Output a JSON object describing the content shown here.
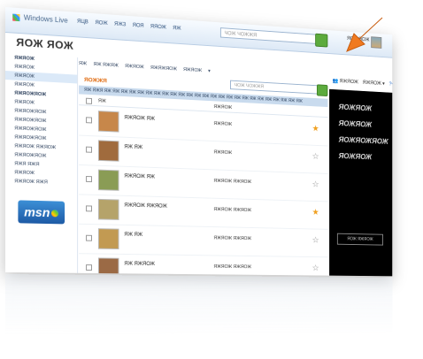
{
  "header": {
    "brand": "Windows Live",
    "nav": [
      "ЯЦВ",
      "ЯОЖ",
      "ЯЖЗ",
      "ЯОЯ",
      "ЯЯОЖ",
      "ЯЖ"
    ],
    "search_placeholder": "ЧОЖ ЧОЖЖЯ",
    "user": "ЯОЯ ЯОЖ"
  },
  "page": {
    "title": "ЯОЖ ЯОЖ"
  },
  "sidebar": {
    "items": [
      {
        "label": "ЯЖЯОЖ",
        "selected": false,
        "header": true
      },
      {
        "label": "ЯЖЯОЖ",
        "selected": false
      },
      {
        "label": "ЯЖЯОЖ",
        "selected": true
      },
      {
        "label": "ЯЖЯОЖ",
        "selected": false
      },
      {
        "label": "ЯЖЯОЖЯОЖ",
        "selected": false,
        "header": true
      },
      {
        "label": "ЯЖЯОЖ",
        "selected": false
      },
      {
        "label": "ЯЖЯОЖЯОЖ",
        "selected": false
      },
      {
        "label": "ЯЖЯОЖЯОЖ",
        "selected": false
      },
      {
        "label": "ЯЖЯОЖЯОЖ",
        "selected": false
      },
      {
        "label": "ЯЖЯОЖЯОЖ",
        "selected": false
      },
      {
        "label": "ЯЖЯОЖ ЯЖЯОЖ",
        "selected": false
      },
      {
        "label": "ЯЖЯОЖЯОЖ",
        "selected": false
      },
      {
        "label": "ЯЖЯ ЯЖЯ",
        "selected": false
      },
      {
        "label": "ЯЖЯОЖ",
        "selected": false
      },
      {
        "label": "ЯЖЯОЖ ЯЖЯ",
        "selected": false
      }
    ],
    "msn_label": "msn"
  },
  "toolbar": {
    "items": [
      "ЯЖ",
      "ЯЖ ЯЖЯЖ",
      "ЯЖЯОЖ",
      "ЯЖЯЖЯОЖ",
      "ЯЖЯОЖ",
      "▾"
    ],
    "filter_placeholder": "ЧОЖ ЧОЖЖЯ",
    "folder_name": "ЯОЖЖЯ",
    "bluebar_text": "ЯЖ ЯЖЯ ЯЖ ЯЖ ЯЖ ЯЖ ЯЖ ЯЖ ЯЖ ЯЖ ЯЖ ЯЖ ЯЖ ЯЖ ЯЖ ЯЖ ЯЖ ЯЖ ЯЖ ЯЖ ЯЖ ЯЖ ЯЖ ЯЖ ЯЖ ЯЖ ЯЖ"
  },
  "columns": {
    "from": "ЯЖ",
    "subject": "ЯЖЯОЖ"
  },
  "messages": [
    {
      "name": "ЯЖЯОЖ ЯЖ",
      "subject": "ЯЖЯОЖ",
      "starred": true,
      "thumb": "#c7874a"
    },
    {
      "name": "ЯЖ ЯЖ",
      "subject": "ЯЖЯОЖ",
      "starred": false,
      "thumb": "#a06b3d"
    },
    {
      "name": "ЯЖЯОЖ ЯЖ",
      "subject": "ЯЖЯОЖ ЯЖЯОЖ",
      "starred": false,
      "thumb": "#8a9c55"
    },
    {
      "name": "ЯЖЯОЖ ЯЖЯОЖ",
      "subject": "ЯЖЯОЖ ЯЖЯОЖ",
      "starred": true,
      "thumb": "#b5a36a"
    },
    {
      "name": "ЯЖ ЯЖ",
      "subject": "ЯЖЯОЖ ЯЖЯОЖ",
      "starred": false,
      "thumb": "#c29a52"
    },
    {
      "name": "ЯЖ ЯЖЯОЖ",
      "subject": "ЯЖЯОЖ ЯЖЯОЖ",
      "starred": false,
      "thumb": "#9b6a45"
    },
    {
      "name": "ЯЖ ЯЖ",
      "subject": "ЯЖЯОЖ ЯЖЯОЖ",
      "starred": true,
      "thumb": "#7d8fa1"
    }
  ],
  "right": {
    "cmd_items": [
      "ЯЖЯОЖ",
      "ЯЖЯОЖ ▾",
      "?▾"
    ],
    "ad_lines": [
      "ЯОЖЯОЖ",
      "ЯОЖЯОЖ",
      "ЯОЖЯОЖЯОЖ",
      "ЯОЖЯОЖ"
    ],
    "ad_button": "ЯОЖ ЯЖЯОЖ"
  },
  "colors": {
    "accent": "#e06b10",
    "highlight": "#dbe9f8",
    "star": "#f0a020"
  }
}
